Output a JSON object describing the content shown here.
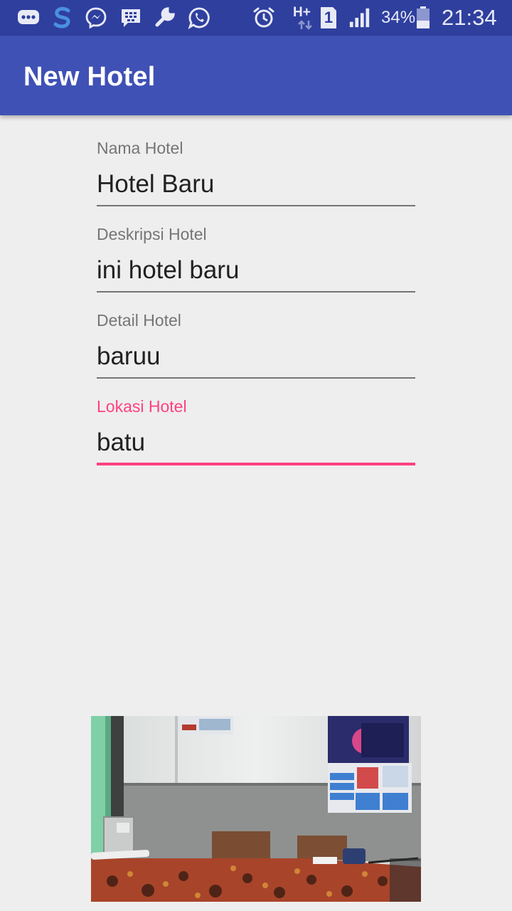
{
  "status_bar": {
    "icons": [
      "chat-bubble-icon",
      "s-app-icon",
      "messenger-icon",
      "bbm-icon",
      "wrench-icon",
      "whatsapp-icon",
      "alarm-icon",
      "network-hplus-icon",
      "sim-one-icon",
      "signal-icon",
      "battery-icon"
    ],
    "network_type": "H+",
    "sim_number": "1",
    "battery_percent": "34%",
    "time": "21:34"
  },
  "app_bar": {
    "title": "New Hotel",
    "color": "#3f51b5"
  },
  "form": {
    "fields": [
      {
        "label": "Nama Hotel",
        "value": "Hotel Baru",
        "focused": false
      },
      {
        "label": "Deskripsi Hotel",
        "value": "ini hotel baru",
        "focused": false
      },
      {
        "label": "Detail Hotel",
        "value": "baruu",
        "focused": false
      },
      {
        "label": "Lokasi Hotel",
        "value": "batu",
        "focused": true
      }
    ],
    "accent_color": "#ff4081"
  },
  "photo": {
    "description": "hotel-room-photo"
  }
}
